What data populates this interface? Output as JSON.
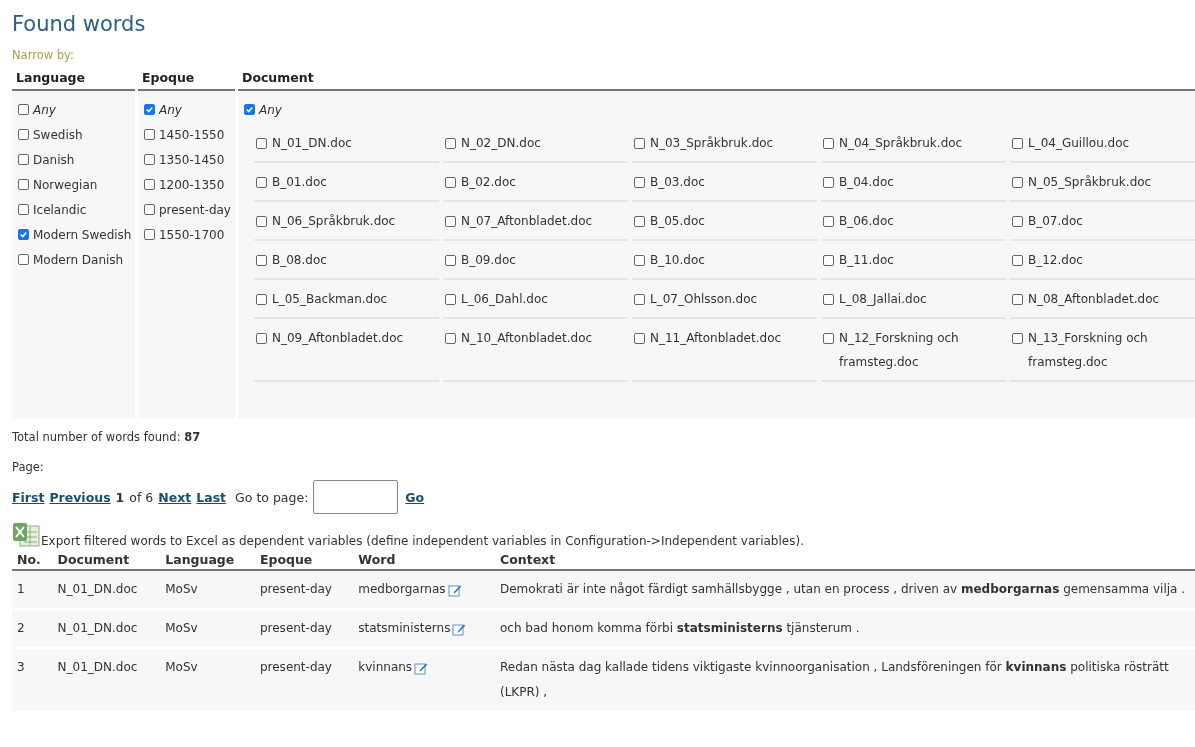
{
  "title": "Found words",
  "narrow_label": "Narrow by:",
  "filters": {
    "language": {
      "heading": "Language",
      "options": [
        {
          "label": "Any",
          "checked": false,
          "any": true
        },
        {
          "label": "Swedish",
          "checked": false
        },
        {
          "label": "Danish",
          "checked": false
        },
        {
          "label": "Norwegian",
          "checked": false
        },
        {
          "label": "Icelandic",
          "checked": false
        },
        {
          "label": "Modern Swedish",
          "checked": true
        },
        {
          "label": "Modern Danish",
          "checked": false
        }
      ]
    },
    "epoque": {
      "heading": "Epoque",
      "options": [
        {
          "label": "Any",
          "checked": true,
          "any": true
        },
        {
          "label": "1450-1550",
          "checked": false
        },
        {
          "label": "1350-1450",
          "checked": false
        },
        {
          "label": "1200-1350",
          "checked": false
        },
        {
          "label": "present-day",
          "checked": false
        },
        {
          "label": "1550-1700",
          "checked": false
        }
      ]
    },
    "document": {
      "heading": "Document",
      "any": {
        "label": "Any",
        "checked": true
      },
      "options": [
        {
          "label": "N_01_DN.doc",
          "checked": false
        },
        {
          "label": "N_02_DN.doc",
          "checked": false
        },
        {
          "label": "N_03_Språkbruk.doc",
          "checked": false
        },
        {
          "label": "N_04_Språkbruk.doc",
          "checked": false
        },
        {
          "label": "L_04_Guillou.doc",
          "checked": false
        },
        {
          "label": "B_01.doc",
          "checked": false
        },
        {
          "label": "B_02.doc",
          "checked": false
        },
        {
          "label": "B_03.doc",
          "checked": false
        },
        {
          "label": "B_04.doc",
          "checked": false
        },
        {
          "label": "N_05_Språkbruk.doc",
          "checked": false
        },
        {
          "label": "N_06_Språkbruk.doc",
          "checked": false
        },
        {
          "label": "N_07_Aftonbladet.doc",
          "checked": false
        },
        {
          "label": "B_05.doc",
          "checked": false
        },
        {
          "label": "B_06.doc",
          "checked": false
        },
        {
          "label": "B_07.doc",
          "checked": false
        },
        {
          "label": "B_08.doc",
          "checked": false
        },
        {
          "label": "B_09.doc",
          "checked": false
        },
        {
          "label": "B_10.doc",
          "checked": false
        },
        {
          "label": "B_11.doc",
          "checked": false
        },
        {
          "label": "B_12.doc",
          "checked": false
        },
        {
          "label": "L_05_Backman.doc",
          "checked": false
        },
        {
          "label": "L_06_Dahl.doc",
          "checked": false
        },
        {
          "label": "L_07_Ohlsson.doc",
          "checked": false
        },
        {
          "label": "L_08_Jallai.doc",
          "checked": false
        },
        {
          "label": "N_08_Aftonbladet.doc",
          "checked": false
        },
        {
          "label": "N_09_Aftonbladet.doc",
          "checked": false
        },
        {
          "label": "N_10_Aftonbladet.doc",
          "checked": false
        },
        {
          "label": "N_11_Aftonbladet.doc",
          "checked": false
        },
        {
          "label": "N_12_Forskning och framsteg.doc",
          "checked": false
        },
        {
          "label": "N_13_Forskning och framsteg.doc",
          "checked": false
        }
      ]
    }
  },
  "total": {
    "label": "Total number of words found:",
    "value": "87"
  },
  "pager": {
    "label": "Page:",
    "first": "First",
    "previous": "Previous",
    "current": "1",
    "of": "of 6",
    "next": "Next",
    "last": "Last",
    "goto_label": "Go to page:",
    "go": "Go"
  },
  "export_text": "Export filtered words to Excel as dependent variables (define independent variables in Configuration->Independent variables).",
  "table": {
    "columns": [
      "No.",
      "Document",
      "Language",
      "Epoque",
      "Word",
      "Context"
    ],
    "rows": [
      {
        "no": "1",
        "document": "N_01_DN.doc",
        "language": "MoSv",
        "epoque": "present-day",
        "word": "medborgarnas",
        "context": "Demokrati är inte något färdigt samhällsbygge , utan en process , driven av **medborgarnas** gemensamma vilja ."
      },
      {
        "no": "2",
        "document": "N_01_DN.doc",
        "language": "MoSv",
        "epoque": "present-day",
        "word": "statsministerns",
        "context": "och bad honom komma förbi **statsministerns** tjänsterum ."
      },
      {
        "no": "3",
        "document": "N_01_DN.doc",
        "language": "MoSv",
        "epoque": "present-day",
        "word": "kvinnans",
        "context": "Redan nästa dag kallade tidens viktigaste kvinnoorganisation , Landsföreningen för **kvinnans** politiska rösträtt (LKPR) ,"
      }
    ]
  }
}
